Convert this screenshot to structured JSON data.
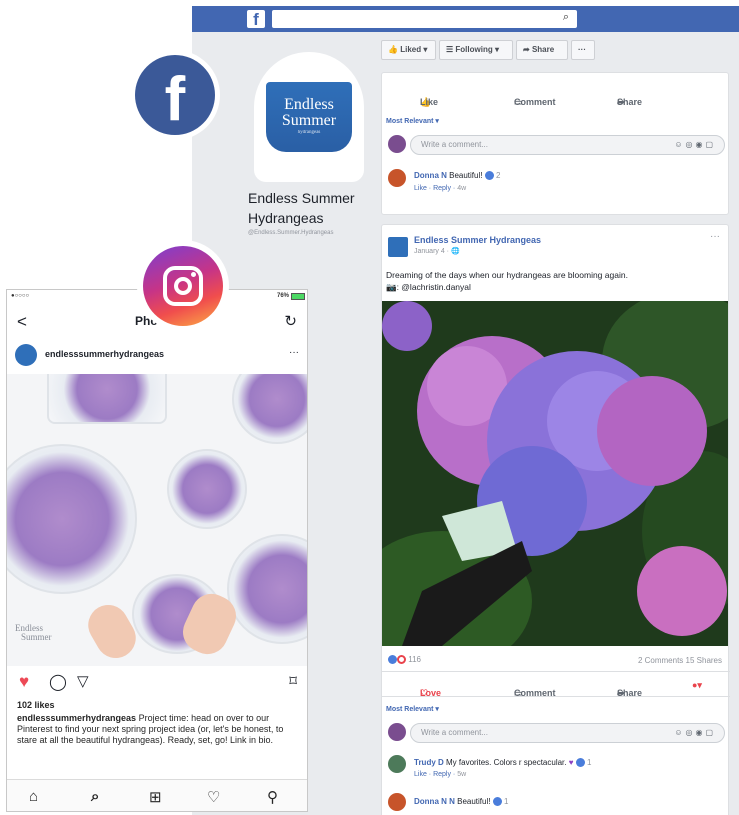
{
  "facebook": {
    "logo_letter": "f",
    "search_icon": "⌕",
    "page": {
      "name": "Endless Summer Hydrangeas",
      "handle": "@Endless.Summer.Hydrangeas",
      "avatar_line1": "Endless",
      "avatar_line2": "Summer",
      "avatar_line3": "hydrangeas"
    },
    "actions": {
      "liked": "Liked ▾",
      "following": "Following ▾",
      "share": "Share",
      "more": "···"
    },
    "post_buttons": {
      "like": "Like",
      "comment": "Comment",
      "share": "Share"
    },
    "most_relevant": "Most Relevant ▾",
    "write_comment": "Write a comment...",
    "comment1": {
      "author": "Donna N",
      "text": "Beautiful!",
      "reactions": "2",
      "like": "Like",
      "reply": "Reply",
      "time": "4w"
    },
    "post": {
      "author": "Endless Summer Hydrangeas",
      "date": "January 4 · ",
      "more": "···",
      "text": "Dreaming of the days when our hydrangeas are blooming again.",
      "credit": "📷: @lachristin.danyal",
      "reaction_count": "116",
      "comments_count": "2 Comments",
      "shares_count": "15 Shares",
      "love": "Love",
      "comment": "Comment",
      "share": "Share"
    },
    "comment2": {
      "author": "Trudy D",
      "text": "My favorites. Colors r spectacular.",
      "reactions": "1",
      "like": "Like",
      "reply": "Reply",
      "time": "5w"
    },
    "comment3": {
      "author": "Donna N N",
      "text": "Beautiful!",
      "reactions": "1"
    }
  },
  "instagram": {
    "status_left": "●○○○○",
    "status_right": "76%",
    "back": "<",
    "title": "Photo",
    "refresh": "↻",
    "username": "endlesssummerhydrangeas",
    "more": "···",
    "likes": "102 likes",
    "caption_user": "endlesssummerhydrangeas",
    "caption_text": " Project time: head on over to our Pinterest to find your next spring project idea (or, let's be honest, to stare at all the beautiful hydrangeas). Ready, set, go! Link in bio.",
    "watermark1": "Endless",
    "watermark2": "Summer"
  },
  "colors": {
    "fb_blue": "#4267b2",
    "fb_logo": "#3b5998",
    "love_red": "#e9434c"
  }
}
